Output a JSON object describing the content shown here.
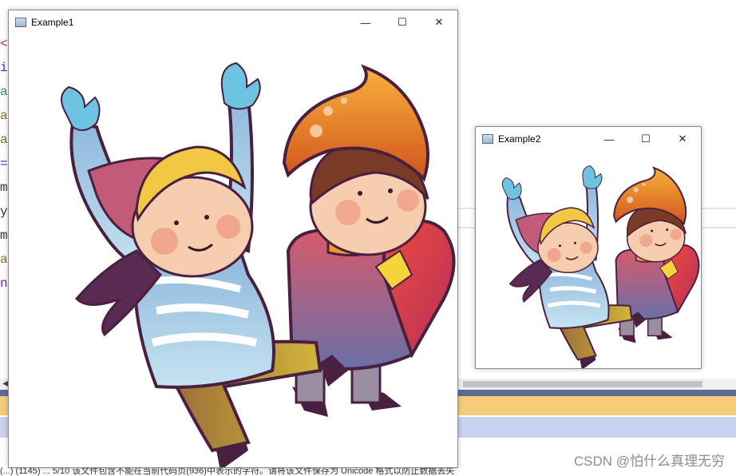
{
  "background": {
    "code_glyphs": [
      "<",
      "i",
      "a",
      "a",
      "a",
      "=",
      "m",
      "y",
      "m",
      "a",
      "n"
    ],
    "code_colors": [
      "#c0392b",
      "#1f3fbf",
      "#1f8f8f",
      "#8a6d1f",
      "#8a6d1f",
      "#1f3fbf",
      "#333333",
      "#333333",
      "#333333",
      "#8a6d1f",
      "#7a1fbf"
    ],
    "strip_colors": [
      "#5d6b95",
      "#f5cd7a",
      "#c6d2ef"
    ],
    "status_text": "(...)  (1145)   ...  5/10   该文件包含不能在当前代码页(936)中表示的字符。请将该文件保存为 Unicode 格式以防止数据丢失",
    "watermark": "CSDN @怕什么真理无穷"
  },
  "windows": [
    {
      "title": "Example1",
      "icon": "app-window-icon"
    },
    {
      "title": "Example2",
      "icon": "app-window-icon"
    }
  ],
  "controls": {
    "minimize": "—",
    "maximize": "☐",
    "close": "✕"
  },
  "image": {
    "description_colors": {
      "orange_hat": "#f29a2e",
      "sweater_blue": "#a9d3ea",
      "scarf_purple": "#5a2a52",
      "mitten_blue": "#6ec3e2",
      "heart_red": "#e23b3b",
      "pants_mustard": "#b99a3a",
      "skin": "#f6c8a8",
      "cheek": "#ef9f8a",
      "hair_yellow": "#f2c744",
      "hair_brown": "#7a3b26"
    }
  }
}
